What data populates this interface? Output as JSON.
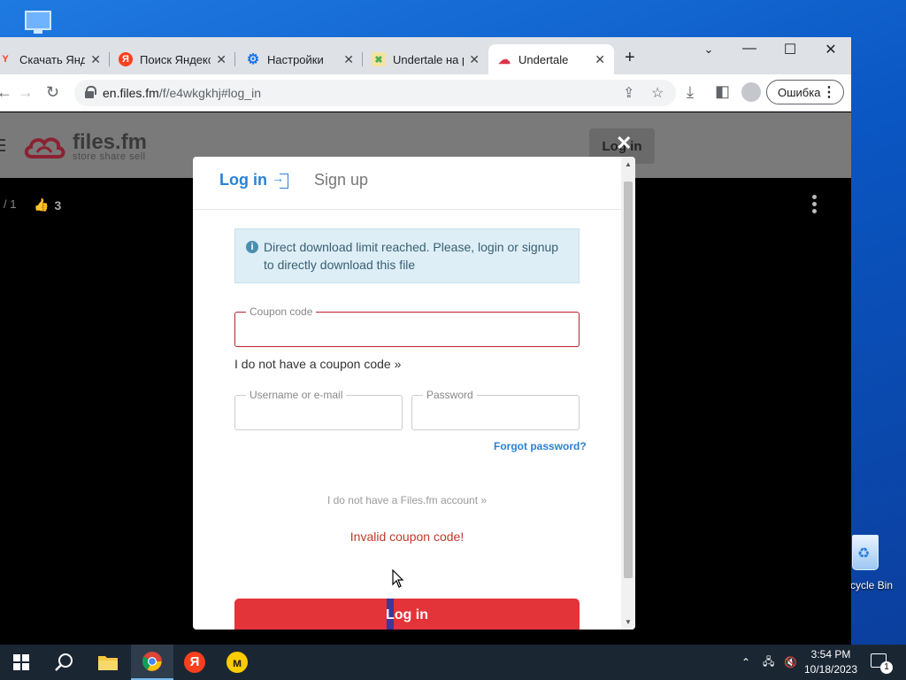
{
  "browser": {
    "tabs": [
      {
        "title": "Скачать Яндекс",
        "favicon": "yandex-y-icon",
        "favicon_color": "#fc3f1d",
        "active": false
      },
      {
        "title": "Поиск Яндекс",
        "favicon": "yandex-search-icon",
        "favicon_color": "#fc3f1d",
        "active": false
      },
      {
        "title": "Настройки",
        "favicon": "gear-icon",
        "favicon_color": "#1a73e8",
        "active": false
      },
      {
        "title": "Undertale на р",
        "favicon": "undertale-icon",
        "favicon_color": "#4caf50",
        "active": false
      },
      {
        "title": "Undertale",
        "favicon": "filesfm-icon",
        "favicon_color": "#d9344a",
        "active": true
      }
    ],
    "new_tab_label": "+",
    "url": "en.files.fm",
    "url_path": "/f/e4wkgkhj#log_in",
    "profile_error_label": "Ошибка"
  },
  "site": {
    "logo_name": "files.fm",
    "logo_tagline": "store share sell",
    "header_login_label": "Log in",
    "meta_left": "/ 1",
    "likes_count": "3",
    "brand_color": "#d9344a"
  },
  "modal": {
    "tab_login": "Log in",
    "tab_signup": "Sign up",
    "alert_text": "Direct download limit reached. Please, login or signup to directly download this file",
    "coupon_label": "Coupon code",
    "coupon_value": "",
    "no_coupon_link": "I do not have a coupon code »",
    "username_label": "Username or e-mail",
    "password_label": "Password",
    "forgot_link": "Forgot password?",
    "no_account_link": "I do not have a Files.fm account »",
    "error_text": "Invalid coupon code!",
    "login_button": "Log in",
    "accent_color": "#2a82d6",
    "button_color": "#e3343a"
  },
  "desktop": {
    "recycle_bin_label": "cycle Bin"
  },
  "taskbar": {
    "time": "3:54 PM",
    "date": "10/18/2023",
    "notification_count": "1"
  }
}
